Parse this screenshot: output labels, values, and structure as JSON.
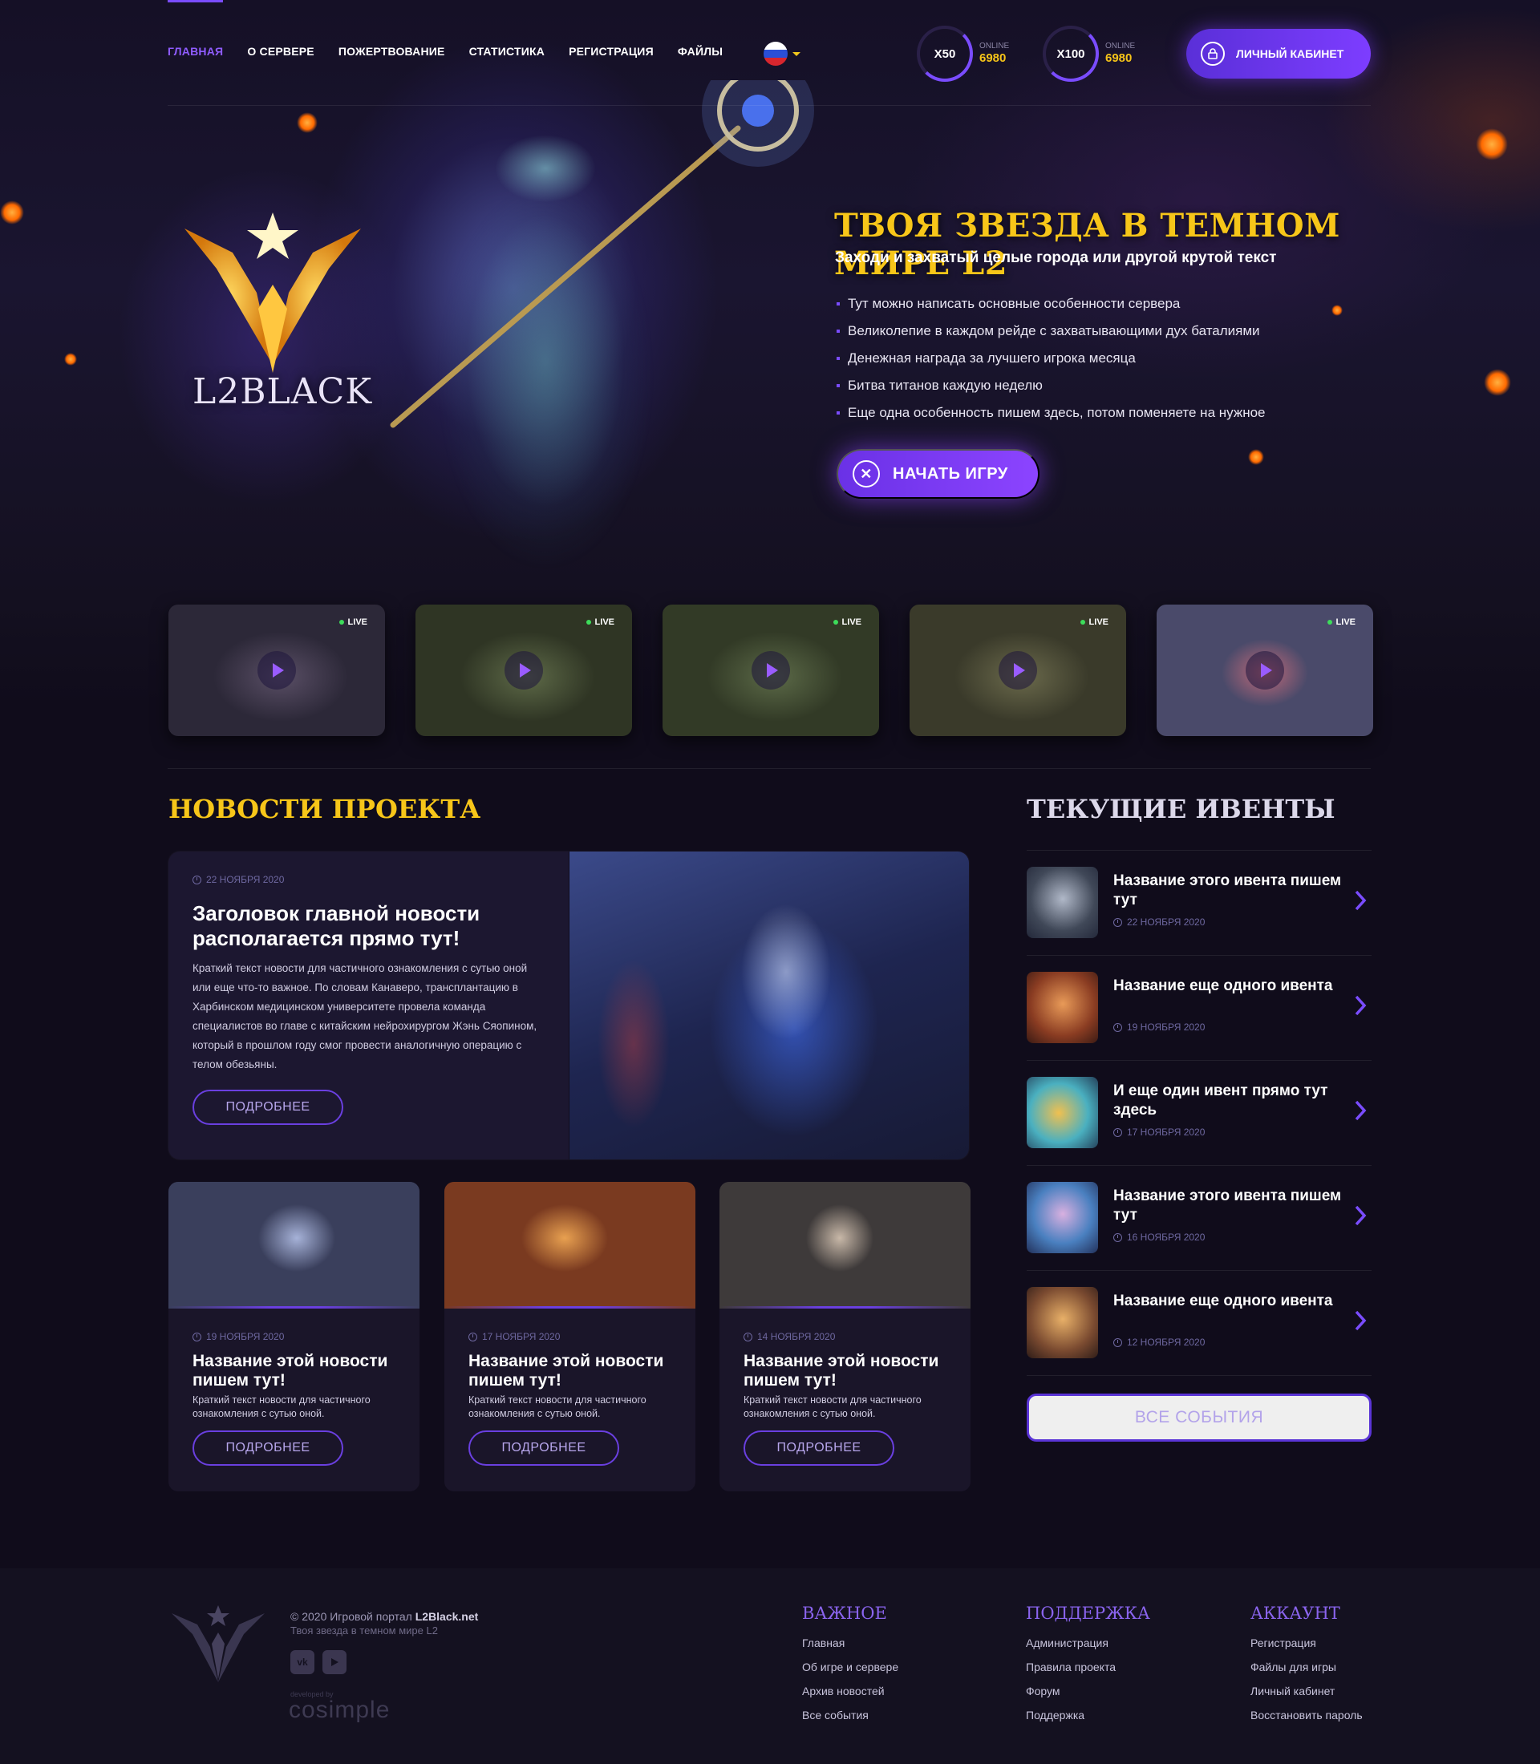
{
  "nav": {
    "items": [
      {
        "label": "ГЛАВНАЯ",
        "active": true
      },
      {
        "label": "О СЕРВЕРЕ"
      },
      {
        "label": "ПОЖЕРТВОВАНИЕ"
      },
      {
        "label": "СТАТИСТИКА"
      },
      {
        "label": "РЕГИСТРАЦИЯ"
      },
      {
        "label": "ФАЙЛЫ"
      }
    ],
    "language": {
      "flag": "russia-flag-icon"
    },
    "servers": [
      {
        "rate": "X50",
        "label": "ONLINE",
        "count": "6980"
      },
      {
        "rate": "X100",
        "label": "ONLINE",
        "count": "6980"
      }
    ],
    "cabinet_label": "ЛИЧНЫЙ КАБИНЕТ"
  },
  "logo": {
    "text": "L2BLACK"
  },
  "hero": {
    "title": "ТВОЯ ЗВЕЗДА В ТЕМНОМ МИРЕ L2",
    "subtitle": "Заходи и захватый целые города или другой крутой текст",
    "features": [
      "Тут можно написать основные особенности сервера",
      "Великолепие в каждом рейде с захватывающими дух баталиями",
      "Денежная награда за лучшего игрока месяца",
      "Битва титанов каждую неделю",
      "Еще одна особенность пишем здесь, потом поменяете на нужное"
    ],
    "start_label": "НАЧАТЬ ИГРУ"
  },
  "streams": [
    {
      "badge": "LIVE"
    },
    {
      "badge": "LIVE"
    },
    {
      "badge": "LIVE"
    },
    {
      "badge": "LIVE"
    },
    {
      "badge": "LIVE"
    }
  ],
  "news": {
    "section_title": "НОВОСТИ ПРОЕКТА",
    "main": {
      "date": "22 НОЯБРЯ 2020",
      "title": "Заголовок главной новости располагается прямо тут!",
      "text": "Краткий текст новости для частичного ознакомления с сутью оной или еще что-то важное. По словам Канаверо, трансплантацию в Харбинском медицинском университете провела команда специалистов во главе с китайским нейрохирургом Жэнь Сяопином, который в прошлом году смог провести аналогичную операцию с телом обезьяны.",
      "more": "ПОДРОБНЕЕ"
    },
    "items": [
      {
        "date": "19 НОЯБРЯ 2020",
        "title": "Название этой новости пишем тут!",
        "text": "Краткий текст новости для частичного ознакомления с сутью оной.",
        "more": "ПОДРОБНЕЕ"
      },
      {
        "date": "17 НОЯБРЯ 2020",
        "title": "Название этой новости пишем тут!",
        "text": "Краткий текст новости для частичного ознакомления с сутью оной.",
        "more": "ПОДРОБНЕЕ"
      },
      {
        "date": "14 НОЯБРЯ 2020",
        "title": "Название этой новости пишем тут!",
        "text": "Краткий текст новости для частичного ознакомления с сутью оной.",
        "more": "ПОДРОБНЕЕ"
      }
    ]
  },
  "events": {
    "section_title": "ТЕКУЩИЕ ИВЕНТЫ",
    "items": [
      {
        "title": "Название этого ивента пишем тут",
        "date": "22 НОЯБРЯ 2020"
      },
      {
        "title": "Название еще одного ивента",
        "date": "19 НОЯБРЯ 2020"
      },
      {
        "title": "И еще один ивент прямо тут здесь",
        "date": "17 НОЯБРЯ 2020"
      },
      {
        "title": "Название этого ивента пишем тут",
        "date": "16 НОЯБРЯ 2020"
      },
      {
        "title": "Название еще одного ивента",
        "date": "12 НОЯБРЯ 2020"
      }
    ],
    "all_label": "ВСЕ СОБЫТИЯ"
  },
  "footer": {
    "copyright_prefix": "© 2020 Игровой портал",
    "copyright_site": "L2Black.net",
    "slogan": "Твоя звезда в темном мире L2",
    "social": [
      "vk-icon",
      "youtube-icon"
    ],
    "developer_label": "developed by",
    "developer": "cosimple",
    "columns": [
      {
        "title": "ВАЖНОЕ",
        "links": [
          "Главная",
          "Об игре и сервере",
          "Архив новостей",
          "Все события"
        ]
      },
      {
        "title": "ПОДДЕРЖКА",
        "links": [
          "Администрация",
          "Правила проекта",
          "Форум",
          "Поддержка"
        ]
      },
      {
        "title": "АККАУНТ",
        "links": [
          "Регистрация",
          "Файлы для игры",
          "Личный кабинет",
          "Восстановить пароль"
        ]
      }
    ]
  },
  "colors": {
    "accent": "#7a4cff",
    "gold": "#f7c619",
    "background": "#100c1b"
  }
}
